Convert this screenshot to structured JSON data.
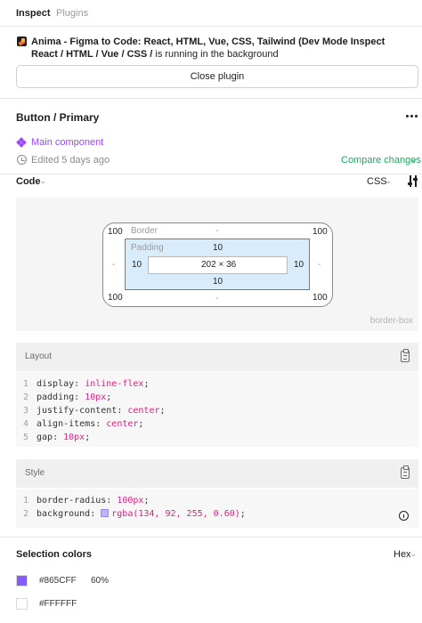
{
  "tabs": [
    {
      "label": "Inspect",
      "active": true
    },
    {
      "label": "Plugins",
      "active": false
    }
  ],
  "plugin_notice": {
    "name": "Anima - Figma to Code: React, HTML, Vue, CSS, Tailwind (Dev Mode Inspect React / HTML / Vue / CSS /",
    "suffix": "is running in the background",
    "close_label": "Close plugin"
  },
  "component": {
    "title": "Button / Primary",
    "main_component_label": "Main component",
    "edited_label": "Edited 5 days ago",
    "compare_label": "Compare changes"
  },
  "code_header": {
    "label": "Code",
    "language": "CSS"
  },
  "box_model": {
    "margin": {
      "top": "-",
      "right": "-",
      "bottom": "-",
      "left": "-"
    },
    "radius": {
      "tl": "100",
      "tr": "100",
      "bl": "100",
      "br": "100"
    },
    "border_label": "Border",
    "border_top": "-",
    "border_bottom": "-",
    "padding_label": "Padding",
    "padding": {
      "top": "10",
      "right": "10",
      "bottom": "10",
      "left": "10"
    },
    "content_size": "202 × 36",
    "box_sizing": "border-box"
  },
  "layout_panel": {
    "title": "Layout",
    "lines": [
      {
        "num": "1",
        "prop": "display",
        "value": "inline-flex"
      },
      {
        "num": "2",
        "prop": "padding",
        "value": "10px"
      },
      {
        "num": "3",
        "prop": "justify-content",
        "value": "center"
      },
      {
        "num": "4",
        "prop": "align-items",
        "value": "center"
      },
      {
        "num": "5",
        "prop": "gap",
        "value": "10px"
      }
    ]
  },
  "style_panel": {
    "title": "Style",
    "lines": [
      {
        "num": "1",
        "prop": "border-radius",
        "value": "100px"
      },
      {
        "num": "2",
        "prop": "background",
        "value": "rgba(134, 92, 255, 0.60)"
      }
    ]
  },
  "selection_colors": {
    "title": "Selection colors",
    "format": "Hex",
    "colors": [
      {
        "hex": "#865CFF",
        "opacity": "60%",
        "swatch": "#865cff"
      },
      {
        "hex": "#FFFFFF",
        "opacity": "",
        "swatch": "#ffffff"
      }
    ]
  },
  "colors": {
    "accent_purple": "#9747ff",
    "compare_green": "#14ae5c",
    "code_value": "#d6247f"
  }
}
